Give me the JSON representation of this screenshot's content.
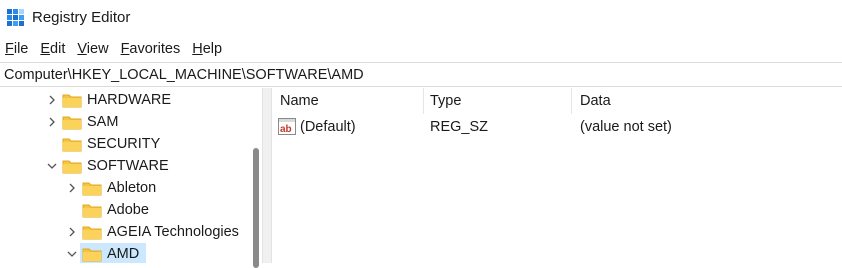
{
  "window": {
    "title": "Registry Editor",
    "app_icon": "registry-editor-icon"
  },
  "menu": [
    {
      "label_first": "F",
      "label_rest": "ile"
    },
    {
      "label_first": "E",
      "label_rest": "dit"
    },
    {
      "label_first": "V",
      "label_rest": "iew"
    },
    {
      "label_first": "F",
      "label_rest": "avorites"
    },
    {
      "label_first": "H",
      "label_rest": "elp"
    }
  ],
  "address": {
    "path": "Computer\\HKEY_LOCAL_MACHINE\\SOFTWARE\\AMD"
  },
  "tree": {
    "items": [
      {
        "label": "HARDWARE",
        "state": "collapsed"
      },
      {
        "label": "SAM",
        "state": "collapsed"
      },
      {
        "label": "SECURITY",
        "state": "leaf"
      },
      {
        "label": "SOFTWARE",
        "state": "expanded"
      },
      {
        "label": "Ableton",
        "state": "collapsed"
      },
      {
        "label": "Adobe",
        "state": "leaf"
      },
      {
        "label": "AGEIA Technologies",
        "state": "collapsed"
      },
      {
        "label": "AMD",
        "state": "expanded",
        "selected": true
      }
    ]
  },
  "list": {
    "columns": [
      "Name",
      "Type",
      "Data"
    ],
    "rows": [
      {
        "name": "(Default)",
        "type": "REG_SZ",
        "data": "(value not set)",
        "icon": "string-value-icon"
      }
    ]
  },
  "colors": {
    "selection": "#cce8ff",
    "folder": "#f5c542",
    "folder_dark": "#e0a820"
  }
}
